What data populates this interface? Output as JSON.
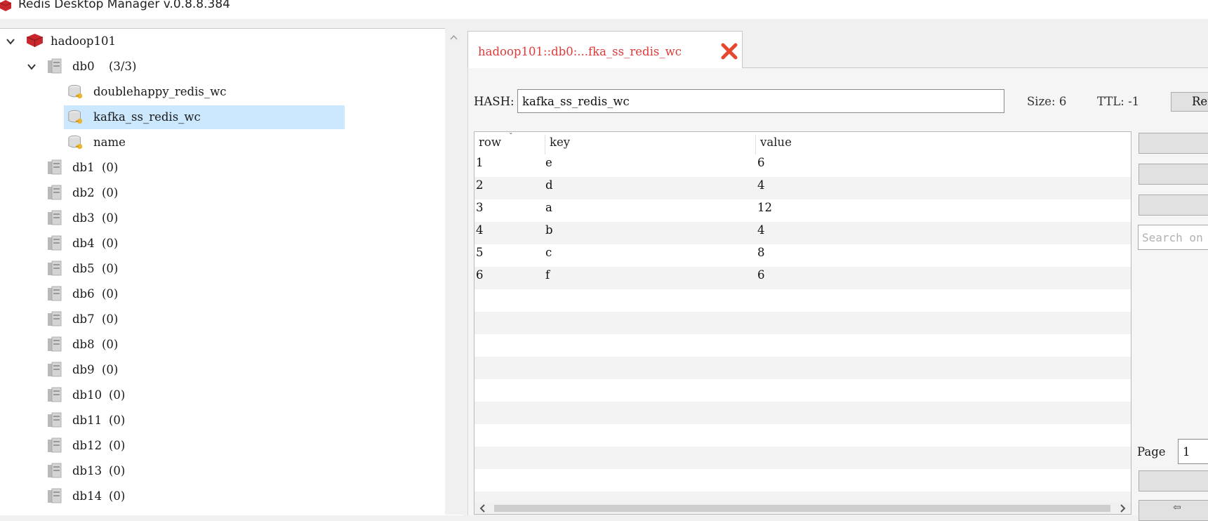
{
  "window": {
    "title": "Redis Desktop Manager v.0.8.8.384"
  },
  "tree": {
    "connection": {
      "label": "hadoop101"
    },
    "databases": [
      {
        "name": "db0",
        "count": "(3/3)",
        "expanded": true
      },
      {
        "name": "db1",
        "count": "(0)"
      },
      {
        "name": "db2",
        "count": "(0)"
      },
      {
        "name": "db3",
        "count": "(0)"
      },
      {
        "name": "db4",
        "count": "(0)"
      },
      {
        "name": "db5",
        "count": "(0)"
      },
      {
        "name": "db6",
        "count": "(0)"
      },
      {
        "name": "db7",
        "count": "(0)"
      },
      {
        "name": "db8",
        "count": "(0)"
      },
      {
        "name": "db9",
        "count": "(0)"
      },
      {
        "name": "db10",
        "count": "(0)"
      },
      {
        "name": "db11",
        "count": "(0)"
      },
      {
        "name": "db12",
        "count": "(0)"
      },
      {
        "name": "db13",
        "count": "(0)"
      },
      {
        "name": "db14",
        "count": "(0)"
      }
    ],
    "keys": [
      {
        "label": "doublehappy_redis_wc",
        "selected": false
      },
      {
        "label": "kafka_ss_redis_wc",
        "selected": true
      },
      {
        "label": "name",
        "selected": false
      }
    ]
  },
  "tab": {
    "title": "hadoop101::db0:...fka_ss_redis_wc",
    "close_icon": "close-x-icon",
    "accent": "#e03a3a"
  },
  "key_view": {
    "type_label": "HASH:",
    "key_name": "kafka_ss_redis_wc",
    "size_text": "Size: 6",
    "ttl_text": "TTL: -1",
    "rename_label": "Ren"
  },
  "table": {
    "headers": [
      "row",
      "key",
      "value"
    ],
    "rows": [
      {
        "row": "1",
        "key": "e",
        "value": "6"
      },
      {
        "row": "2",
        "key": "d",
        "value": "4"
      },
      {
        "row": "3",
        "key": "a",
        "value": "12"
      },
      {
        "row": "4",
        "key": "b",
        "value": "4"
      },
      {
        "row": "5",
        "key": "c",
        "value": "8"
      },
      {
        "row": "6",
        "key": "f",
        "value": "6"
      }
    ]
  },
  "side_panel": {
    "search_placeholder": "Search on",
    "page_label": "Page",
    "page_value": "1"
  },
  "colors": {
    "selection": "#cce8ff",
    "tab_text": "#e03a3a",
    "close_icon": "#e8472f",
    "redis_red": "#c8282d"
  }
}
